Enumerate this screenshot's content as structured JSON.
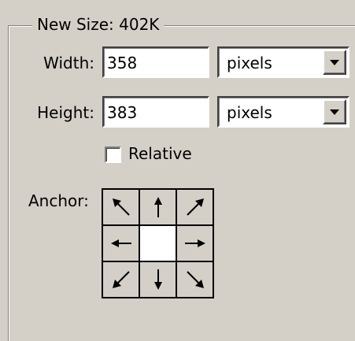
{
  "group": {
    "title": "New Size: 402K"
  },
  "width": {
    "label": "Width:",
    "value": "358",
    "unit": "pixels"
  },
  "height": {
    "label": "Height:",
    "value": "383",
    "unit": "pixels"
  },
  "relative": {
    "label": "Relative",
    "checked": false
  },
  "anchor": {
    "label": "Anchor:",
    "selected": "center",
    "cells": [
      {
        "position": "top-left",
        "icon": "arrow-up-left-icon"
      },
      {
        "position": "top",
        "icon": "arrow-up-icon"
      },
      {
        "position": "top-right",
        "icon": "arrow-up-right-icon"
      },
      {
        "position": "left",
        "icon": "arrow-left-icon"
      },
      {
        "position": "center",
        "icon": ""
      },
      {
        "position": "right",
        "icon": "arrow-right-icon"
      },
      {
        "position": "bottom-left",
        "icon": "arrow-down-left-icon"
      },
      {
        "position": "bottom",
        "icon": "arrow-down-icon"
      },
      {
        "position": "bottom-right",
        "icon": "arrow-down-right-icon"
      }
    ]
  },
  "colors": {
    "panel": "#d4d0c8",
    "field": "#ffffff",
    "text": "#000000"
  }
}
